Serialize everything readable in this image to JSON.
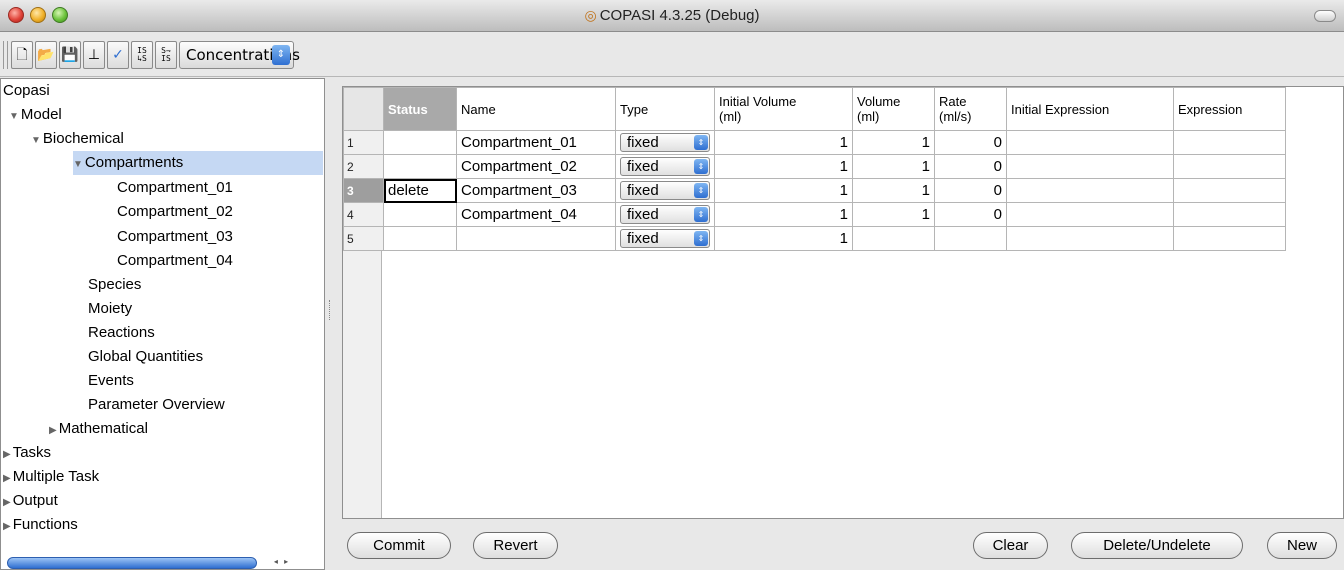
{
  "window": {
    "title": "COPASI 4.3.25 (Debug)"
  },
  "toolbar": {
    "buttons": [
      {
        "icon": "new-file-icon",
        "glyph": "🗋"
      },
      {
        "icon": "open-folder-icon",
        "glyph": "📂"
      },
      {
        "icon": "save-disk-icon",
        "glyph": "💾"
      },
      {
        "icon": "slider-icon",
        "glyph": "⊥"
      },
      {
        "icon": "checkmark-icon",
        "glyph": "✓"
      },
      {
        "icon": "is-to-s-icon",
        "glyph": "IS\n↳S"
      },
      {
        "icon": "s-to-is-icon",
        "glyph": "S⇁\nIS"
      }
    ],
    "mode_select": {
      "value": "Concentrations",
      "arrow": "⇕"
    }
  },
  "tree": {
    "nodes": [
      {
        "label": "Copasi",
        "twisty": ""
      },
      {
        "label": "Model",
        "twisty": "▼"
      },
      {
        "label": "Biochemical",
        "twisty": "▼"
      },
      {
        "label": "Compartments",
        "twisty": "▼"
      },
      {
        "label": "Compartment_01",
        "twisty": ""
      },
      {
        "label": "Compartment_02",
        "twisty": ""
      },
      {
        "label": "Compartment_03",
        "twisty": ""
      },
      {
        "label": "Compartment_04",
        "twisty": ""
      },
      {
        "label": "Species",
        "twisty": ""
      },
      {
        "label": "Moiety",
        "twisty": ""
      },
      {
        "label": "Reactions",
        "twisty": ""
      },
      {
        "label": "Global Quantities",
        "twisty": ""
      },
      {
        "label": "Events",
        "twisty": ""
      },
      {
        "label": "Parameter Overview",
        "twisty": ""
      },
      {
        "label": "Mathematical",
        "twisty": "▶"
      },
      {
        "label": "Tasks",
        "twisty": "▶"
      },
      {
        "label": "Multiple Task",
        "twisty": "▶"
      },
      {
        "label": "Output",
        "twisty": "▶"
      },
      {
        "label": "Functions",
        "twisty": "▶"
      }
    ],
    "scroll_arrows": "◂ ▸"
  },
  "table": {
    "headers": {
      "status": "Status",
      "name": "Name",
      "type": "Type",
      "initial_volume": "Initial Volume\n(ml)",
      "volume": "Volume\n(ml)",
      "rate": "Rate\n(ml/s)",
      "initial_expression": "Initial Expression",
      "expression": "Expression"
    },
    "rows": [
      {
        "num": "1",
        "status": "",
        "name": "Compartment_01",
        "type": "fixed",
        "initial_volume": "1",
        "volume": "1",
        "rate": "0",
        "initial_expression": "",
        "expression": ""
      },
      {
        "num": "2",
        "status": "",
        "name": "Compartment_02",
        "type": "fixed",
        "initial_volume": "1",
        "volume": "1",
        "rate": "0",
        "initial_expression": "",
        "expression": ""
      },
      {
        "num": "3",
        "status": "delete",
        "name": "Compartment_03",
        "type": "fixed",
        "initial_volume": "1",
        "volume": "1",
        "rate": "0",
        "initial_expression": "",
        "expression": ""
      },
      {
        "num": "4",
        "status": "",
        "name": "Compartment_04",
        "type": "fixed",
        "initial_volume": "1",
        "volume": "1",
        "rate": "0",
        "initial_expression": "",
        "expression": ""
      },
      {
        "num": "5",
        "status": "",
        "name": "",
        "type": "fixed",
        "initial_volume": "1",
        "volume": "",
        "rate": "",
        "initial_expression": "",
        "expression": ""
      }
    ],
    "select_arrow": "⇕"
  },
  "buttons": {
    "commit": "Commit",
    "revert": "Revert",
    "clear": "Clear",
    "delete_undelete": "Delete/Undelete",
    "new": "New"
  }
}
